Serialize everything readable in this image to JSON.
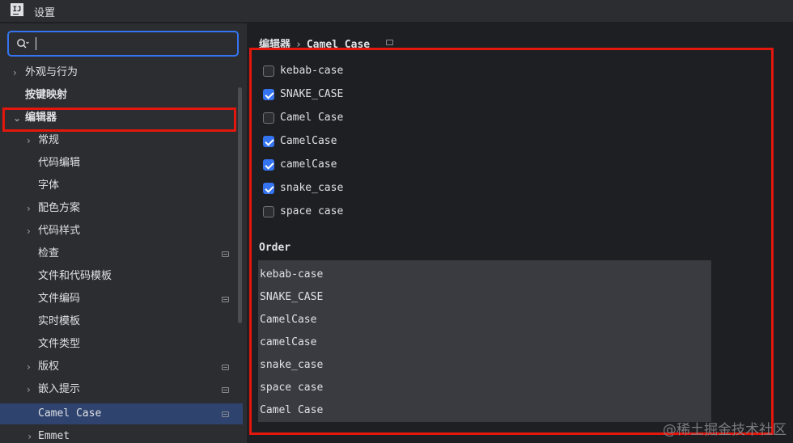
{
  "window": {
    "title": "设置",
    "logo_text": "IJ"
  },
  "search": {
    "value": "",
    "placeholder": ""
  },
  "sidebar": {
    "items": [
      {
        "label": "外观与行为",
        "chevron": "›"
      },
      {
        "label": "按键映射",
        "chevron": ""
      },
      {
        "label": "编辑器",
        "chevron": "⌄"
      },
      {
        "label": "常规",
        "chevron": "›"
      },
      {
        "label": "代码编辑",
        "chevron": ""
      },
      {
        "label": "字体",
        "chevron": ""
      },
      {
        "label": "配色方案",
        "chevron": "›"
      },
      {
        "label": "代码样式",
        "chevron": "›"
      },
      {
        "label": "检查",
        "chevron": ""
      },
      {
        "label": "文件和代码模板",
        "chevron": ""
      },
      {
        "label": "文件编码",
        "chevron": ""
      },
      {
        "label": "实时模板",
        "chevron": ""
      },
      {
        "label": "文件类型",
        "chevron": ""
      },
      {
        "label": "版权",
        "chevron": "›"
      },
      {
        "label": "嵌入提示",
        "chevron": "›"
      },
      {
        "label": "Camel Case",
        "chevron": ""
      },
      {
        "label": "Emmet",
        "chevron": "›"
      }
    ]
  },
  "breadcrumb": {
    "parent": "编辑器",
    "separator": "›",
    "current": "Camel Case"
  },
  "options": [
    {
      "label": "kebab-case",
      "checked": false
    },
    {
      "label": "SNAKE_CASE",
      "checked": true
    },
    {
      "label": "Camel Case",
      "checked": false
    },
    {
      "label": "CamelCase",
      "checked": true
    },
    {
      "label": "camelCase",
      "checked": true
    },
    {
      "label": "snake_case",
      "checked": true
    },
    {
      "label": "space case",
      "checked": false
    }
  ],
  "order": {
    "label": "Order",
    "items": [
      "kebab-case",
      "SNAKE_CASE",
      "CamelCase",
      "camelCase",
      "snake_case",
      "space case",
      "Camel Case"
    ]
  },
  "watermark": "@稀土掘金技术社区",
  "colors": {
    "accent": "#3574f0",
    "highlight": "#e3170d",
    "selection": "#2e436e"
  }
}
